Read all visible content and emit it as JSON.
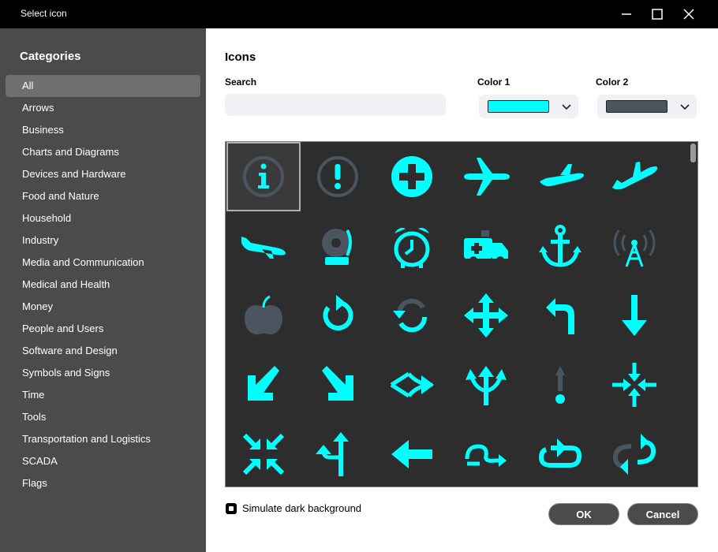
{
  "window": {
    "title": "Select icon"
  },
  "sidebar": {
    "heading": "Categories",
    "items": [
      {
        "label": "All"
      },
      {
        "label": "Arrows"
      },
      {
        "label": "Business"
      },
      {
        "label": "Charts and Diagrams"
      },
      {
        "label": "Devices and Hardware"
      },
      {
        "label": "Food and Nature"
      },
      {
        "label": "Household"
      },
      {
        "label": "Industry"
      },
      {
        "label": "Media and Communication"
      },
      {
        "label": "Medical and Health"
      },
      {
        "label": "Money"
      },
      {
        "label": "People and Users"
      },
      {
        "label": "Software and Design"
      },
      {
        "label": "Symbols and Signs"
      },
      {
        "label": "Time"
      },
      {
        "label": "Tools"
      },
      {
        "label": "Transportation and Logistics"
      },
      {
        "label": "SCADA"
      },
      {
        "label": "Flags"
      }
    ],
    "selected": "All"
  },
  "main": {
    "heading": "Icons",
    "search_label": "Search",
    "search_value": "",
    "color1_label": "Color 1",
    "color2_label": "Color 2",
    "color1": "#00ffff",
    "color2": "#4a5560",
    "simulate_label": "Simulate dark background",
    "simulate_checked": true,
    "ok_label": "OK",
    "cancel_label": "Cancel"
  },
  "icons": [
    "info-circle-icon",
    "exclamation-circle-icon",
    "medical-cross-icon",
    "airplane-icon",
    "airplane-takeoff-icon",
    "airplane-takeoff-alt-icon",
    "airplane-landing-icon",
    "alarm-bell-icon",
    "alarm-clock-icon",
    "ambulance-icon",
    "anchor-icon",
    "antenna-icon",
    "apple-icon",
    "arrow-circle-icon",
    "arrow-sync-icon",
    "arrow-move-icon",
    "arrow-turn-left-icon",
    "arrow-down-icon",
    "arrow-down-left-icon",
    "arrow-down-right-icon",
    "arrow-merge-left-icon",
    "arrow-split-up-icon",
    "arrow-exclamation-up-icon",
    "arrows-collapse-icon",
    "arrows-compress-icon",
    "arrow-fork-up-icon",
    "arrow-left-icon",
    "arrow-loop-right-icon",
    "arrow-repeat-icon",
    "arrow-repeat-alt-icon"
  ]
}
